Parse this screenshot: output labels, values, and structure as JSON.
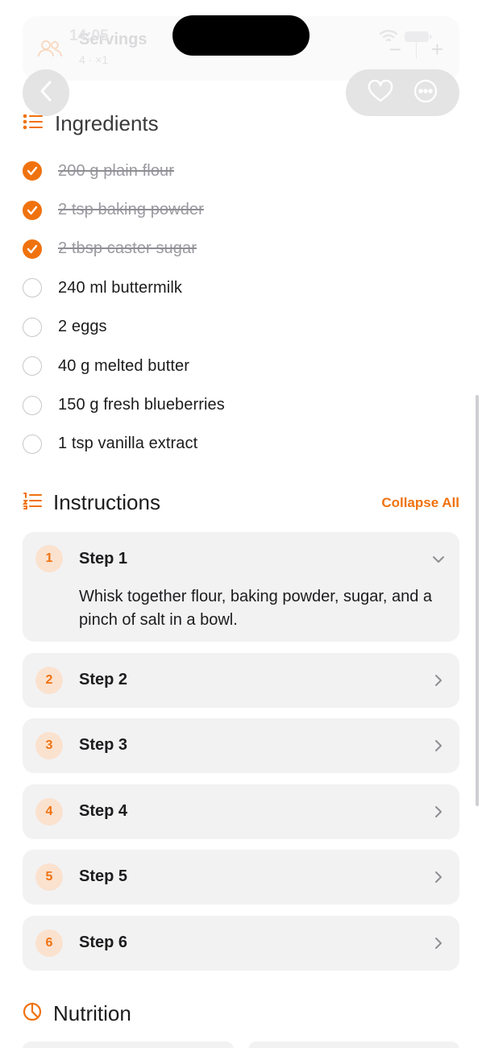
{
  "status_bar": {
    "time": "14:05"
  },
  "servings": {
    "title": "Servings",
    "subtitle": "4 · ×1",
    "minus": "−",
    "plus": "+"
  },
  "ingredients": {
    "title": "Ingredients",
    "items": [
      {
        "text": "200 g plain flour",
        "checked": true
      },
      {
        "text": "2 tsp baking powder",
        "checked": true
      },
      {
        "text": "2 tbsp caster sugar",
        "checked": true
      },
      {
        "text": "240 ml buttermilk",
        "checked": false
      },
      {
        "text": "2 eggs",
        "checked": false
      },
      {
        "text": "40 g melted butter",
        "checked": false
      },
      {
        "text": "150 g fresh blueberries",
        "checked": false
      },
      {
        "text": "1 tsp vanilla extract",
        "checked": false
      }
    ]
  },
  "instructions": {
    "title": "Instructions",
    "collapse_label": "Collapse All",
    "steps": [
      {
        "number": "1",
        "title": "Step 1",
        "expanded": true,
        "description": "Whisk together flour, baking powder, sugar, and a pinch of salt in a bowl."
      },
      {
        "number": "2",
        "title": "Step 2",
        "expanded": false
      },
      {
        "number": "3",
        "title": "Step 3",
        "expanded": false
      },
      {
        "number": "4",
        "title": "Step 4",
        "expanded": false
      },
      {
        "number": "5",
        "title": "Step 5",
        "expanded": false
      },
      {
        "number": "6",
        "title": "Step 6",
        "expanded": false
      }
    ]
  },
  "nutrition": {
    "title": "Nutrition"
  },
  "colors": {
    "accent": "#f0720f",
    "card": "#f2f2f3",
    "badge": "#fbe2cf"
  },
  "icons": {
    "back": "chevron-left-icon",
    "favorite": "heart-icon",
    "more": "ellipsis-icon",
    "ingredients": "list-icon",
    "instructions": "numbered-list-icon",
    "nutrition": "pie-chart-icon"
  }
}
